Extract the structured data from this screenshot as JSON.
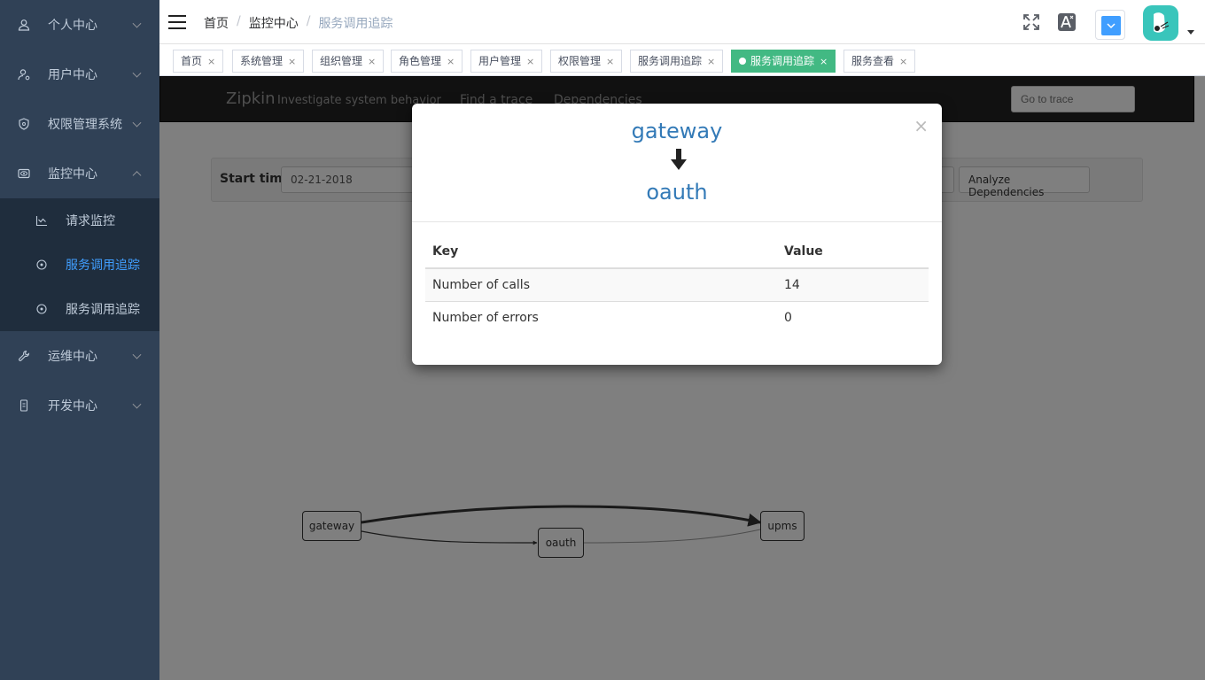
{
  "sidebar": {
    "menu": [
      {
        "label": "个人中心",
        "icon": "user-icon"
      },
      {
        "label": "用户中心",
        "icon": "user-settings-icon"
      },
      {
        "label": "权限管理系统",
        "icon": "shield-icon"
      },
      {
        "label": "监控中心",
        "icon": "eye-icon"
      },
      {
        "label": "运维中心",
        "icon": "wrench-icon"
      },
      {
        "label": "开发中心",
        "icon": "phone-icon"
      }
    ],
    "submenu": [
      {
        "label": "请求监控",
        "icon": "chart-icon"
      },
      {
        "label": "服务调用追踪",
        "icon": "target-icon",
        "active": true
      },
      {
        "label": "服务调用追踪",
        "icon": "target-icon"
      }
    ]
  },
  "header": {
    "breadcrumb": [
      "首页",
      "监控中心",
      "服务调用追踪"
    ]
  },
  "tags": [
    {
      "label": "首页"
    },
    {
      "label": "系统管理"
    },
    {
      "label": "组织管理"
    },
    {
      "label": "角色管理"
    },
    {
      "label": "用户管理"
    },
    {
      "label": "权限管理"
    },
    {
      "label": "服务调用追踪"
    },
    {
      "label": "服务调用追踪",
      "active": true
    },
    {
      "label": "服务查看"
    }
  ],
  "zipkin": {
    "brand": "Zipkin",
    "tagline": "Investigate system behavior",
    "nav": [
      "Find a trace",
      "Dependencies"
    ],
    "goto_placeholder": "Go to trace",
    "start_label": "Start time",
    "start_value": "02-21-2018",
    "analyze_button": "Analyze Dependencies",
    "nodes": [
      "gateway",
      "oauth",
      "upms"
    ]
  },
  "modal": {
    "close": "×",
    "from": "gateway",
    "to": "oauth",
    "table": {
      "headers": [
        "Key",
        "Value"
      ],
      "rows": [
        [
          "Number of calls",
          "14"
        ],
        [
          "Number of errors",
          "0"
        ]
      ]
    }
  },
  "colors": {
    "sidebar_bg": "#304156",
    "submenu_bg": "#1f2d3d",
    "active_blue": "#409eff",
    "active_tag": "#42b983",
    "link_blue": "#337ab7",
    "avatar_bg": "#39c5bb"
  }
}
